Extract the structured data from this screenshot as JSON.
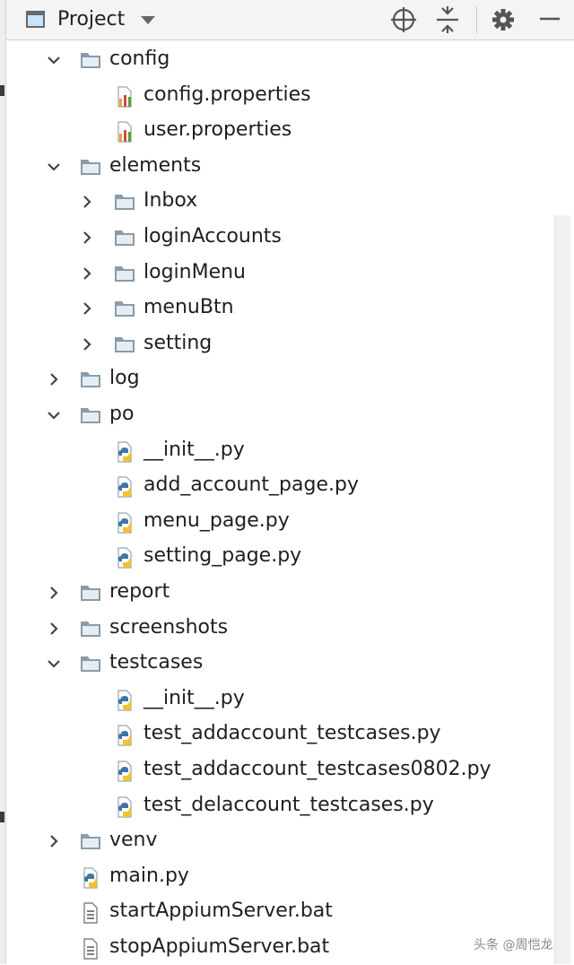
{
  "panel": {
    "title": "Project",
    "toolbar": [
      {
        "name": "locate-icon"
      },
      {
        "name": "collapse-all-icon"
      },
      {
        "name": "gear-icon"
      },
      {
        "name": "minimize-icon"
      }
    ]
  },
  "tree": [
    {
      "label": "config",
      "type": "folder",
      "level": 1,
      "expanded": true
    },
    {
      "label": "config.properties",
      "type": "properties",
      "level": 2
    },
    {
      "label": "user.properties",
      "type": "properties",
      "level": 2
    },
    {
      "label": "elements",
      "type": "folder",
      "level": 1,
      "expanded": true
    },
    {
      "label": "Inbox",
      "type": "folder",
      "level": 2,
      "expanded": false
    },
    {
      "label": "loginAccounts",
      "type": "folder",
      "level": 2,
      "expanded": false
    },
    {
      "label": "loginMenu",
      "type": "folder",
      "level": 2,
      "expanded": false
    },
    {
      "label": "menuBtn",
      "type": "folder",
      "level": 2,
      "expanded": false
    },
    {
      "label": "setting",
      "type": "folder",
      "level": 2,
      "expanded": false
    },
    {
      "label": "log",
      "type": "folder",
      "level": 1,
      "expanded": false
    },
    {
      "label": "po",
      "type": "folder",
      "level": 1,
      "expanded": true
    },
    {
      "label": "__init__.py",
      "type": "python",
      "level": 2
    },
    {
      "label": "add_account_page.py",
      "type": "python",
      "level": 2
    },
    {
      "label": "menu_page.py",
      "type": "python",
      "level": 2
    },
    {
      "label": "setting_page.py",
      "type": "python",
      "level": 2
    },
    {
      "label": "report",
      "type": "folder",
      "level": 1,
      "expanded": false
    },
    {
      "label": "screenshots",
      "type": "folder",
      "level": 1,
      "expanded": false
    },
    {
      "label": "testcases",
      "type": "folder",
      "level": 1,
      "expanded": true
    },
    {
      "label": "__init__.py",
      "type": "python",
      "level": 2
    },
    {
      "label": "test_addaccount_testcases.py",
      "type": "python",
      "level": 2
    },
    {
      "label": "test_addaccount_testcases0802.py",
      "type": "python",
      "level": 2
    },
    {
      "label": "test_delaccount_testcases.py",
      "type": "python",
      "level": 2
    },
    {
      "label": "venv",
      "type": "folder",
      "level": 1,
      "expanded": false
    },
    {
      "label": "main.py",
      "type": "python",
      "level": 1
    },
    {
      "label": "startAppiumServer.bat",
      "type": "bat",
      "level": 1
    },
    {
      "label": "stopAppiumServer.bat",
      "type": "bat",
      "level": 1
    }
  ],
  "watermark": "头条 @周恺龙",
  "colors": {
    "folder": "#8a9ba8",
    "python_blue": "#3f74a6",
    "python_yellow": "#f2c230",
    "properties_bars": [
      "#e8a23a",
      "#d04b3d",
      "#5a9c3e"
    ]
  }
}
